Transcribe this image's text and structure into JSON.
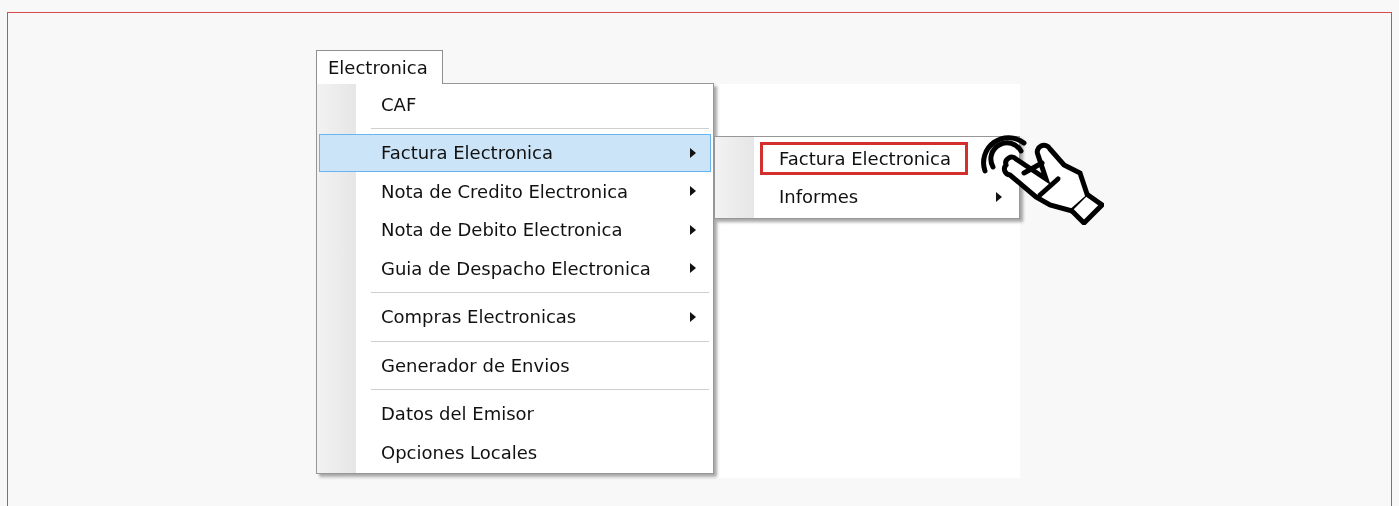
{
  "menu_bar": [
    {
      "label": "Electronica",
      "selected": true
    }
  ],
  "menu": {
    "items": [
      {
        "kind": "item",
        "label": "CAF",
        "submenu": false,
        "selected": false
      },
      {
        "kind": "separator"
      },
      {
        "kind": "item",
        "label": "Factura Electronica",
        "submenu": true,
        "selected": true
      },
      {
        "kind": "item",
        "label": "Nota de Credito Electronica",
        "submenu": true,
        "selected": false
      },
      {
        "kind": "item",
        "label": "Nota de Debito Electronica",
        "submenu": true,
        "selected": false
      },
      {
        "kind": "item",
        "label": "Guia de Despacho Electronica",
        "submenu": true,
        "selected": false
      },
      {
        "kind": "separator"
      },
      {
        "kind": "item",
        "label": "Compras Electronicas",
        "submenu": true,
        "selected": false
      },
      {
        "kind": "separator"
      },
      {
        "kind": "item",
        "label": "Generador de Envios",
        "submenu": false,
        "selected": false
      },
      {
        "kind": "separator"
      },
      {
        "kind": "item",
        "label": "Datos del Emisor",
        "submenu": false,
        "selected": false
      },
      {
        "kind": "item",
        "label": "Opciones Locales",
        "submenu": false,
        "selected": false
      }
    ]
  },
  "submenu": {
    "items": [
      {
        "kind": "item",
        "label": "Factura Electronica",
        "submenu": false,
        "annotated": true
      },
      {
        "kind": "item",
        "label": "Informes",
        "submenu": true,
        "annotated": false
      }
    ]
  }
}
